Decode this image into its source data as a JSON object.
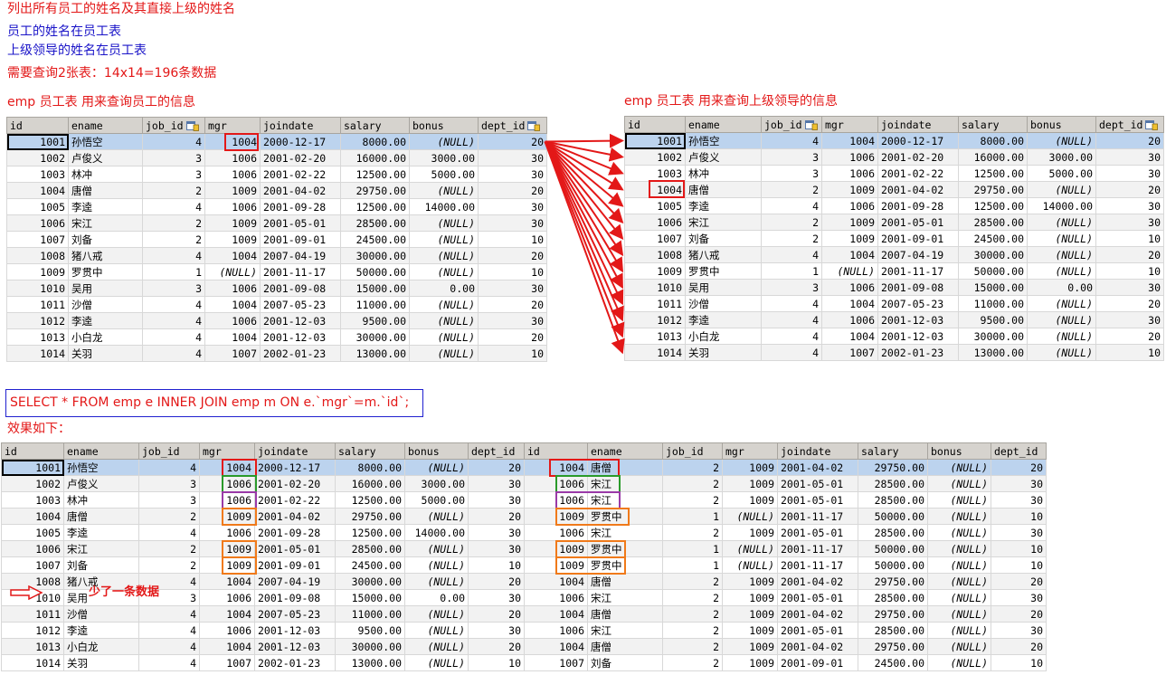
{
  "notes": {
    "line1": "列出所有员工的姓名及其直接上级的姓名",
    "line2": "员工的姓名在员工表",
    "line3": "上级领导的姓名在员工表",
    "line4": "需要查询2张表：14x14=196条数据",
    "left_caption": "emp 员工表  用来查询员工的信息",
    "right_caption": "emp 员工表  用来查询上级领导的信息",
    "sql": "SELECT * FROM emp e INNER JOIN emp m ON e.`mgr`=m.`id`;",
    "effect": "效果如下：",
    "missing": "少了一条数据"
  },
  "colors": {
    "red": "#e31818",
    "blue": "#1a14c8",
    "green": "#2a9a2a",
    "purple": "#9a3aa8",
    "orange": "#f07a1a"
  },
  "icons": {
    "header_key": "table-key-icon",
    "arrow": "right-arrow-icon"
  },
  "emp": {
    "columns": [
      "id",
      "ename",
      "job_id",
      "mgr",
      "joindate",
      "salary",
      "bonus",
      "dept_id"
    ],
    "rows": [
      [
        "1001",
        "孙悟空",
        "4",
        "1004",
        "2000-12-17",
        "8000.00",
        "(NULL)",
        "20"
      ],
      [
        "1002",
        "卢俊义",
        "3",
        "1006",
        "2001-02-20",
        "16000.00",
        "3000.00",
        "30"
      ],
      [
        "1003",
        "林冲",
        "3",
        "1006",
        "2001-02-22",
        "12500.00",
        "5000.00",
        "30"
      ],
      [
        "1004",
        "唐僧",
        "2",
        "1009",
        "2001-04-02",
        "29750.00",
        "(NULL)",
        "20"
      ],
      [
        "1005",
        "李逵",
        "4",
        "1006",
        "2001-09-28",
        "12500.00",
        "14000.00",
        "30"
      ],
      [
        "1006",
        "宋江",
        "2",
        "1009",
        "2001-05-01",
        "28500.00",
        "(NULL)",
        "30"
      ],
      [
        "1007",
        "刘备",
        "2",
        "1009",
        "2001-09-01",
        "24500.00",
        "(NULL)",
        "10"
      ],
      [
        "1008",
        "猪八戒",
        "4",
        "1004",
        "2007-04-19",
        "30000.00",
        "(NULL)",
        "20"
      ],
      [
        "1009",
        "罗贯中",
        "1",
        "(NULL)",
        "2001-11-17",
        "50000.00",
        "(NULL)",
        "10"
      ],
      [
        "1010",
        "吴用",
        "3",
        "1006",
        "2001-09-08",
        "15000.00",
        "0.00",
        "30"
      ],
      [
        "1011",
        "沙僧",
        "4",
        "1004",
        "2007-05-23",
        "11000.00",
        "(NULL)",
        "20"
      ],
      [
        "1012",
        "李逵",
        "4",
        "1006",
        "2001-12-03",
        "9500.00",
        "(NULL)",
        "30"
      ],
      [
        "1013",
        "小白龙",
        "4",
        "1004",
        "2001-12-03",
        "30000.00",
        "(NULL)",
        "20"
      ],
      [
        "1014",
        "关羽",
        "4",
        "1007",
        "2002-01-23",
        "13000.00",
        "(NULL)",
        "10"
      ]
    ]
  },
  "result": {
    "columns": [
      "id",
      "ename",
      "job_id",
      "mgr",
      "joindate",
      "salary",
      "bonus",
      "dept_id",
      "id",
      "ename",
      "job_id",
      "mgr",
      "joindate",
      "salary",
      "bonus",
      "dept_id"
    ],
    "rows": [
      [
        "1001",
        "孙悟空",
        "4",
        "1004",
        "2000-12-17",
        "8000.00",
        "(NULL)",
        "20",
        "1004",
        "唐僧",
        "2",
        "1009",
        "2001-04-02",
        "29750.00",
        "(NULL)",
        "20"
      ],
      [
        "1002",
        "卢俊义",
        "3",
        "1006",
        "2001-02-20",
        "16000.00",
        "3000.00",
        "30",
        "1006",
        "宋江",
        "2",
        "1009",
        "2001-05-01",
        "28500.00",
        "(NULL)",
        "30"
      ],
      [
        "1003",
        "林冲",
        "3",
        "1006",
        "2001-02-22",
        "12500.00",
        "5000.00",
        "30",
        "1006",
        "宋江",
        "2",
        "1009",
        "2001-05-01",
        "28500.00",
        "(NULL)",
        "30"
      ],
      [
        "1004",
        "唐僧",
        "2",
        "1009",
        "2001-04-02",
        "29750.00",
        "(NULL)",
        "20",
        "1009",
        "罗贯中",
        "1",
        "(NULL)",
        "2001-11-17",
        "50000.00",
        "(NULL)",
        "10"
      ],
      [
        "1005",
        "李逵",
        "4",
        "1006",
        "2001-09-28",
        "12500.00",
        "14000.00",
        "30",
        "1006",
        "宋江",
        "2",
        "1009",
        "2001-05-01",
        "28500.00",
        "(NULL)",
        "30"
      ],
      [
        "1006",
        "宋江",
        "2",
        "1009",
        "2001-05-01",
        "28500.00",
        "(NULL)",
        "30",
        "1009",
        "罗贯中",
        "1",
        "(NULL)",
        "2001-11-17",
        "50000.00",
        "(NULL)",
        "10"
      ],
      [
        "1007",
        "刘备",
        "2",
        "1009",
        "2001-09-01",
        "24500.00",
        "(NULL)",
        "10",
        "1009",
        "罗贯中",
        "1",
        "(NULL)",
        "2001-11-17",
        "50000.00",
        "(NULL)",
        "10"
      ],
      [
        "1008",
        "猪八戒",
        "4",
        "1004",
        "2007-04-19",
        "30000.00",
        "(NULL)",
        "20",
        "1004",
        "唐僧",
        "2",
        "1009",
        "2001-04-02",
        "29750.00",
        "(NULL)",
        "20"
      ],
      [
        "1010",
        "吴用",
        "3",
        "1006",
        "2001-09-08",
        "15000.00",
        "0.00",
        "30",
        "1006",
        "宋江",
        "2",
        "1009",
        "2001-05-01",
        "28500.00",
        "(NULL)",
        "30"
      ],
      [
        "1011",
        "沙僧",
        "4",
        "1004",
        "2007-05-23",
        "11000.00",
        "(NULL)",
        "20",
        "1004",
        "唐僧",
        "2",
        "1009",
        "2001-04-02",
        "29750.00",
        "(NULL)",
        "20"
      ],
      [
        "1012",
        "李逵",
        "4",
        "1006",
        "2001-12-03",
        "9500.00",
        "(NULL)",
        "30",
        "1006",
        "宋江",
        "2",
        "1009",
        "2001-05-01",
        "28500.00",
        "(NULL)",
        "30"
      ],
      [
        "1013",
        "小白龙",
        "4",
        "1004",
        "2001-12-03",
        "30000.00",
        "(NULL)",
        "20",
        "1004",
        "唐僧",
        "2",
        "1009",
        "2001-04-02",
        "29750.00",
        "(NULL)",
        "20"
      ],
      [
        "1014",
        "关羽",
        "4",
        "1007",
        "2002-01-23",
        "13000.00",
        "(NULL)",
        "10",
        "1007",
        "刘备",
        "2",
        "1009",
        "2001-09-01",
        "24500.00",
        "(NULL)",
        "10"
      ]
    ]
  }
}
